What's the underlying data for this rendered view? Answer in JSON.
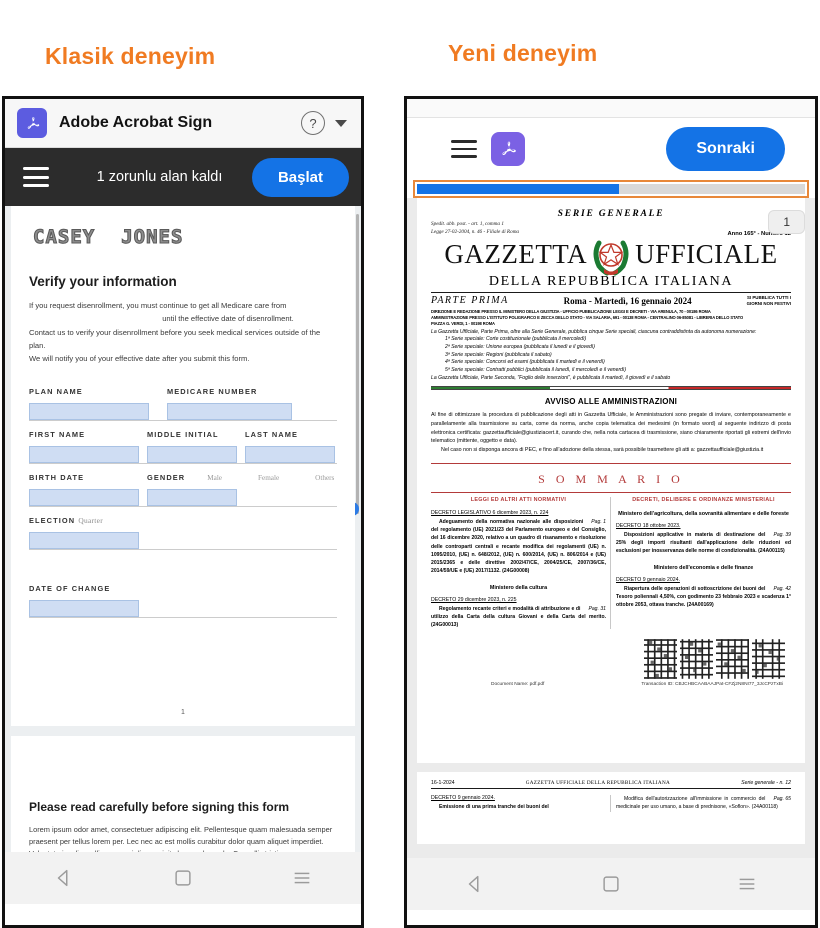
{
  "headings": {
    "left": "Klasik deneyim",
    "right": "Yeni deneyim",
    "accent_color": "#F07B22"
  },
  "left_phone": {
    "app_bar": {
      "app_name": "Adobe Acrobat Sign",
      "logo_icon": "acrobat-logo-icon",
      "help_icon": "help-question-icon",
      "help_label": "?",
      "caret_icon": "chevron-down-icon"
    },
    "action_bar": {
      "menu_icon": "hamburger-menu-icon",
      "required_fields_text": "1 zorunlu alan kaldı",
      "start_label": "Başlat",
      "start_color": "#1473E6"
    },
    "document": {
      "stencil_first": "CASEY",
      "stencil_last": "JONES",
      "section_title": "Verify your information",
      "paragraph_line1": "If you request disenrollment, you must continue to get all Medicare care from",
      "paragraph_line2": "until the effective date of disenrollment.",
      "paragraph_line3": "Contact us to verify your disenrollment before you seek medical services outside of the plan.",
      "paragraph_line4": "We will notify you of your effective date after you submit this form.",
      "fields_row1": [
        "PLAN NAME",
        "MEDICARE NUMBER"
      ],
      "fields_row2": [
        "FIRST NAME",
        "MIDDLE INITIAL",
        "LAST NAME"
      ],
      "birth_date_label": "BIRTH DATE",
      "gender_label": "GENDER",
      "gender_options": [
        "Male",
        "Female",
        "Others"
      ],
      "election_label": "ELECTION",
      "election_sub": "Quarter",
      "date_of_change_label": "DATE OF CHANGE",
      "page_number": "1",
      "page2_title": "Please read carefully before signing this form",
      "page2_body": "Lorem ipsum odor amet, consectetuer adipiscing elit. Pellentesque quam malesuada semper praesent per tellus lorem per. Lec nec ac est mollis curabitur dolor quam aliquet imperdiet. Vulputate iaculis mollis sem orci dis suscipit class malesuada. Convallis tristique accumsan parturient fermentum varius pellentesque conubia fringilla Himenaeos ullamcorper interdum; pretium vivamus sodales platea nec. Pellentesque augue dapibus arcu imperdiet ipsum."
    },
    "nav_bar": {
      "back_icon": "triangle-back-icon",
      "home_icon": "square-home-icon",
      "recents_icon": "hamburger-recents-icon"
    }
  },
  "right_phone": {
    "app_bar": {
      "menu_icon": "hamburger-menu-icon",
      "logo_icon": "acrobat-logo-icon",
      "next_label": "Sonraki",
      "next_color": "#1473E6"
    },
    "progress": {
      "percent": 52,
      "fill_color": "#1473E6",
      "track_color": "#d9d9d9",
      "highlight_color": "#E8883A"
    },
    "page_badge": "1",
    "document": {
      "serie": "SERIE  GENERALE",
      "spedizione_line1": "Spedit. abb. post. - art. 1, comma 1",
      "spedizione_line2": "Legge 27-02-2004, n. 46 - Filiale di Roma",
      "anno": "Anno 165° - Numero 12",
      "title_left": "GAZZETTA",
      "title_right": "UFFICIALE",
      "emblem_icon": "italy-emblem-icon",
      "subtitle": "DELLA REPUBBLICA ITALIANA",
      "parte": "PARTE  PRIMA",
      "date": "Roma - Martedì, 16 gennaio 2024",
      "pubblica_line1": "SI PUBBLICA TUTTI I",
      "pubblica_line2": "GIORNI NON FESTIVI",
      "address_line1": "DIREZIONE E REDAZIONE PRESSO IL MINISTERO DELLA GIUSTIZIA - UFFICIO PUBBLICAZIONE LEGGI E DECRETI - VIA ARENULA, 70 - 00186 ROMA",
      "address_line2": "AMMINISTRAZIONE PRESSO L'ISTITUTO POLIGRAFICO E ZECCA DELLO STATO - VIA SALARIA, 691 - 00138 ROMA - CENTRALINO 06-85081 - LIBRERIA DELLO STATO",
      "address_line3": "PIAZZA G. VERDI, 1 - 00198 ROMA",
      "note_intro": "La Gazzetta Ufficiale, Parte Prima, oltre alla Serie Generale, pubblica cinque Serie speciali, ciascuna contraddistinta da autonoma numerazione:",
      "serie_list": [
        "1ª Serie speciale: Corte costituzionale (pubblicata il mercoledì)",
        "2ª Serie speciale: Unione europea (pubblicata il lunedì e il giovedì)",
        "3ª Serie speciale: Regioni (pubblicata il sabato)",
        "4ª Serie speciale: Concorsi ed esami (pubblicata il martedì e il venerdì)",
        "5ª Serie speciale: Contratti pubblici (pubblicata il lunedì, il mercoledì e il venerdì)"
      ],
      "note_outro": "La Gazzetta Ufficiale, Parte Seconda, \"Foglio delle inserzioni\", è pubblicata il martedì, il giovedì e il sabato",
      "avviso_title": "AVVISO ALLE AMMINISTRAZIONI",
      "avviso_p1": "Al fine di ottimizzare la procedura di pubblicazione degli atti in Gazzetta Ufficiale, le Amministrazioni sono pregate di inviare, contemporaneamente e parallelamente alla trasmissione su carta, come da norma, anche copia telematica dei medesimi (in formato word) al seguente indirizzo di posta elettronica certificata: gazzettaufficiale@giustiziacert.it, curando che, nella nota cartacea di trasmissione, siano chiaramente riportati gli estremi dell'invio telematico (mittente, oggetto e data).",
      "avviso_p2": "Nel caso non si disponga ancora di PEC, e fino all'adozione della stessa, sarà possibile trasmettere gli atti a: gazzettaufficiale@giustizia.it",
      "sommario": "S O M M A R I O",
      "col_left_head": "LEGGI ED ALTRI ATTI NORMATIVI",
      "col_right_head": "DECRETI, DELIBERE E ORDINANZE MINISTERIALI",
      "left_entries": [
        {
          "decreto": "DECRETO LEGISLATIVO 6 dicembre 2023, n. 224",
          "text": "Adeguamento della normativa nazionale alle disposizioni del regolamento (UE) 2021/23 del Parlamento europeo e del Consiglio, del 16 dicembre 2020, relativo a un quadro di risanamento e risoluzione delle controparti centrali e recante modifica dei regolamenti (UE) n. 1095/2010, (UE) n. 648/2012, (UE) n. 600/2014, (UE) n. 806/2014 e (UE) 2015/2365 e delle direttive 2002/47/CE, 2004/25/CE, 2007/36/CE, 2014/59/UE e (UE) 2017/1132. (24G00008)",
          "pag": "Pag.  1"
        },
        {
          "ministero": "Ministero della cultura",
          "decreto": "DECRETO 29 dicembre 2023, n. 225",
          "text": "Regolamento recante criteri e modalità di attribuzione e di utilizzo della Carta della cultura Giovani e della Carta del merito. (24G00013)",
          "pag": "Pag.  31"
        }
      ],
      "right_entries": [
        {
          "ministero": "Ministero dell'agricoltura, della sovranità alimentare e delle foreste",
          "decreto": "DECRETO 18 ottobre 2023.",
          "text": "Disposizioni applicative in materia di destinazione del 25% degli importi risultanti dall'applicazione delle riduzioni ed esclusioni per inosservanza delle norme di condizionalità. (24A00115)",
          "pag": "Pag.  39"
        },
        {
          "ministero": "Ministero dell'economia e delle finanze",
          "decreto": "DECRETO 9 gennaio 2024.",
          "text": "Riapertura delle operazioni di sottoscrizione dei buoni del Tesoro poliennali 4,50%, con godimento 23 febbraio 2023 e scadenza 1° ottobre 2053, ottava tranche. (24A00169)",
          "pag": "Pag.  42"
        }
      ],
      "footer_doc_name": "Document Name: pdf.pdf",
      "footer_transaction": "Transaction ID: CBJCHBCAABAAJPat-CFZj2N8NI77_3JcCPzTxBi",
      "page2_date": "16-1-2024",
      "page2_center": "GAZZETTA UFFICIALE DELLA REPUBBLICA ITALIANA",
      "page2_right": "Serie generale - n. 12",
      "page2_left_decreto": "DECRETO 9 gennaio 2024.",
      "page2_left_text": "Emissione di una prima tranche dei buoni del",
      "page2_right_text": "Modifica dell'autorizzazione all'immissione in commercio del medicinale per uso umano, a base di prednisone, «Soflon». (24A00118)",
      "page2_right_pag": "Pag.  65"
    },
    "nav_bar": {
      "back_icon": "triangle-back-icon",
      "home_icon": "square-home-icon",
      "recents_icon": "hamburger-recents-icon"
    }
  }
}
